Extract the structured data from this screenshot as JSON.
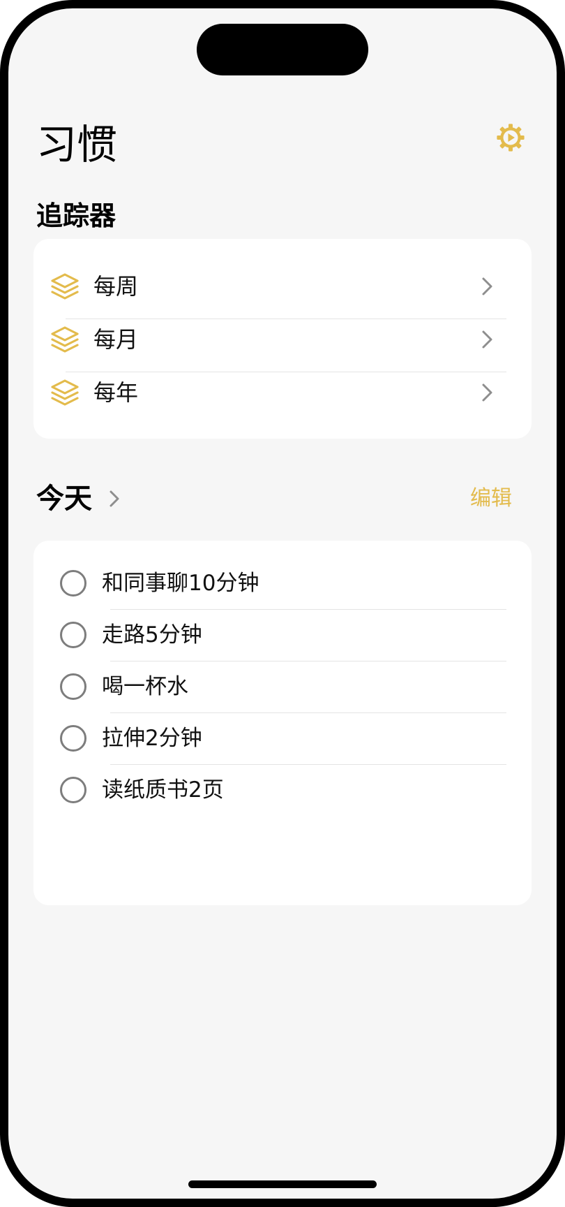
{
  "header": {
    "title": "习惯",
    "settings_icon": "gear-icon"
  },
  "trackers": {
    "section_title": "追踪器",
    "items": [
      {
        "label": "每周",
        "icon": "layers-icon"
      },
      {
        "label": "每月",
        "icon": "layers-icon"
      },
      {
        "label": "每年",
        "icon": "layers-icon"
      }
    ]
  },
  "today": {
    "title": "今天",
    "edit_label": "编辑",
    "habits": [
      {
        "label": "和同事聊10分钟",
        "done": false
      },
      {
        "label": "走路5分钟",
        "done": false
      },
      {
        "label": "喝一杯水",
        "done": false
      },
      {
        "label": "拉伸2分钟",
        "done": false
      },
      {
        "label": "读纸质书2页",
        "done": false
      }
    ]
  },
  "colors": {
    "accent": "#e3bb4c",
    "background": "#f6f6f6",
    "card": "#ffffff",
    "chevron": "#8e8e8e",
    "checkbox_border": "#7d7d7d"
  }
}
